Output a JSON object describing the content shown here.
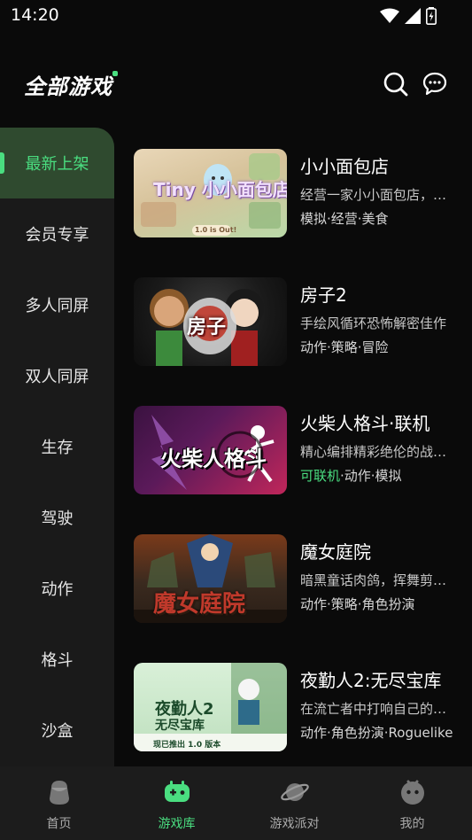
{
  "status_bar": {
    "time": "14:20"
  },
  "header": {
    "title": "全部游戏"
  },
  "sidebar": {
    "items": [
      {
        "label": "最新上架"
      },
      {
        "label": "会员专享"
      },
      {
        "label": "多人同屏"
      },
      {
        "label": "双人同屏"
      },
      {
        "label": "生存"
      },
      {
        "label": "驾驶"
      },
      {
        "label": "动作"
      },
      {
        "label": "格斗"
      },
      {
        "label": "沙盒"
      }
    ]
  },
  "games": [
    {
      "name": "小小面包店",
      "desc": "经营一家小小面包店，…",
      "tags": "模拟·经营·美食",
      "thumb_title": "Tiny 小小面包店",
      "thumb_badge": "1.0 is Out!"
    },
    {
      "name": "房子2",
      "desc": "手绘风循环恐怖解密佳作",
      "tags": "动作·策略·冒险",
      "thumb_title": "房子"
    },
    {
      "name": "火柴人格斗·联机",
      "desc": "精心编排精彩绝伦的战…",
      "tag_highlight": "可联机",
      "tags": "·动作·模拟",
      "thumb_title": "火柴人格斗"
    },
    {
      "name": "魔女庭院",
      "desc": "暗黑童话肉鸽，挥舞剪…",
      "tags": "动作·策略·角色扮演",
      "thumb_title": "魔女庭院"
    },
    {
      "name": "夜勤人2:无尽宝库",
      "desc": "在流亡者中打响自己的…",
      "tags": "动作·角色扮演·Roguelike",
      "thumb_title_1": "夜勤人2",
      "thumb_title_2": "无尽宝库",
      "thumb_badge": "现已推出 1.0 版本"
    }
  ],
  "bottom_nav": {
    "tabs": [
      {
        "label": "首页"
      },
      {
        "label": "游戏库"
      },
      {
        "label": "游戏派对"
      },
      {
        "label": "我的"
      }
    ]
  },
  "colors": {
    "accent": "#4ade80",
    "background": "#0a0a0a",
    "sidebar": "#1a1a1a",
    "sidebar_active": "#2f4a2f"
  }
}
